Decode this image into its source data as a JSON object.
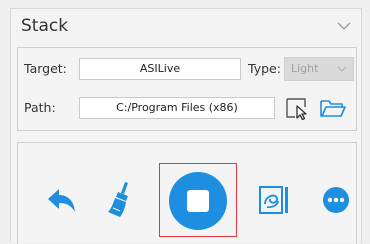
{
  "panel": {
    "title": "Stack",
    "collapse_icon": "chevron-down-icon"
  },
  "fields": {
    "target_label": "Target:",
    "target_value": "ASILive",
    "type_label": "Type:",
    "type_value": "Light",
    "path_label": "Path:",
    "path_value": "C:/Program Files (x86)"
  },
  "path_buttons": {
    "select_icon": "cursor-select-icon",
    "open_folder_icon": "folder-open-icon"
  },
  "actions": [
    {
      "name": "back",
      "icon": "reply-arrow-icon"
    },
    {
      "name": "clear",
      "icon": "broom-icon"
    },
    {
      "name": "stop",
      "icon": "stop-icon",
      "highlighted": true
    },
    {
      "name": "view",
      "icon": "image-viewer-icon"
    },
    {
      "name": "more",
      "icon": "more-icon"
    }
  ],
  "colors": {
    "accent": "#1e90e6",
    "highlight_border": "#e23a3a",
    "disabled_select": "#dadada"
  }
}
